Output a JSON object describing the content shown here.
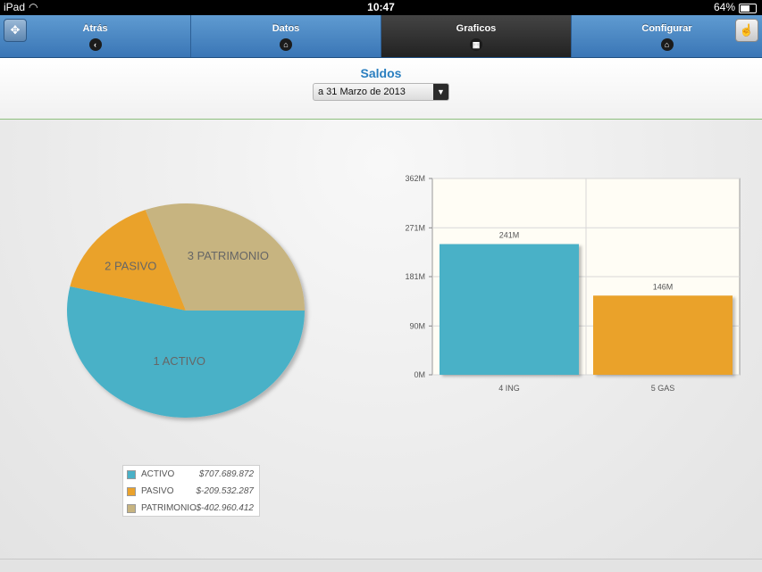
{
  "status": {
    "carrier": "iPad",
    "time": "10:47",
    "battery": "64%"
  },
  "nav": {
    "tabs": [
      {
        "label": "Atrás",
        "icon": "‹"
      },
      {
        "label": "Datos",
        "icon": "⌂"
      },
      {
        "label": "Graficos",
        "icon": "▦"
      },
      {
        "label": "Configurar",
        "icon": "⌂"
      }
    ],
    "active_tab": "Graficos"
  },
  "header": {
    "title": "Saldos",
    "date_select": "a 31 Marzo de 2013"
  },
  "chart_data": [
    {
      "type": "pie",
      "slices": [
        {
          "label": "1 ACTIVO",
          "value": 707689872,
          "color": "#4ab1c7"
        },
        {
          "label": "2 PASIVO",
          "value": 209532287,
          "color": "#eaa22c"
        },
        {
          "label": "3 PATRIMONIO",
          "value": 402960412,
          "color": "#c7b480"
        }
      ],
      "legend": [
        {
          "name": "ACTIVO",
          "value": "$707.689.872",
          "color": "#4ab1c7"
        },
        {
          "name": "PASIVO",
          "value": "$-209.532.287",
          "color": "#eaa22c"
        },
        {
          "name": "PATRIMONIO",
          "value": "$-402.960.412",
          "color": "#c7b480"
        }
      ]
    },
    {
      "type": "bar",
      "categories": [
        "4 ING",
        "5 GAS"
      ],
      "values": [
        241,
        146
      ],
      "value_labels": [
        "241M",
        "146M"
      ],
      "colors": [
        "#4ab1c7",
        "#eaa22c"
      ],
      "ylim": [
        0,
        362
      ],
      "yticks": [
        0,
        90,
        181,
        271,
        362
      ],
      "ytick_labels": [
        "0M",
        "90M",
        "181M",
        "271M",
        "362M"
      ]
    }
  ]
}
